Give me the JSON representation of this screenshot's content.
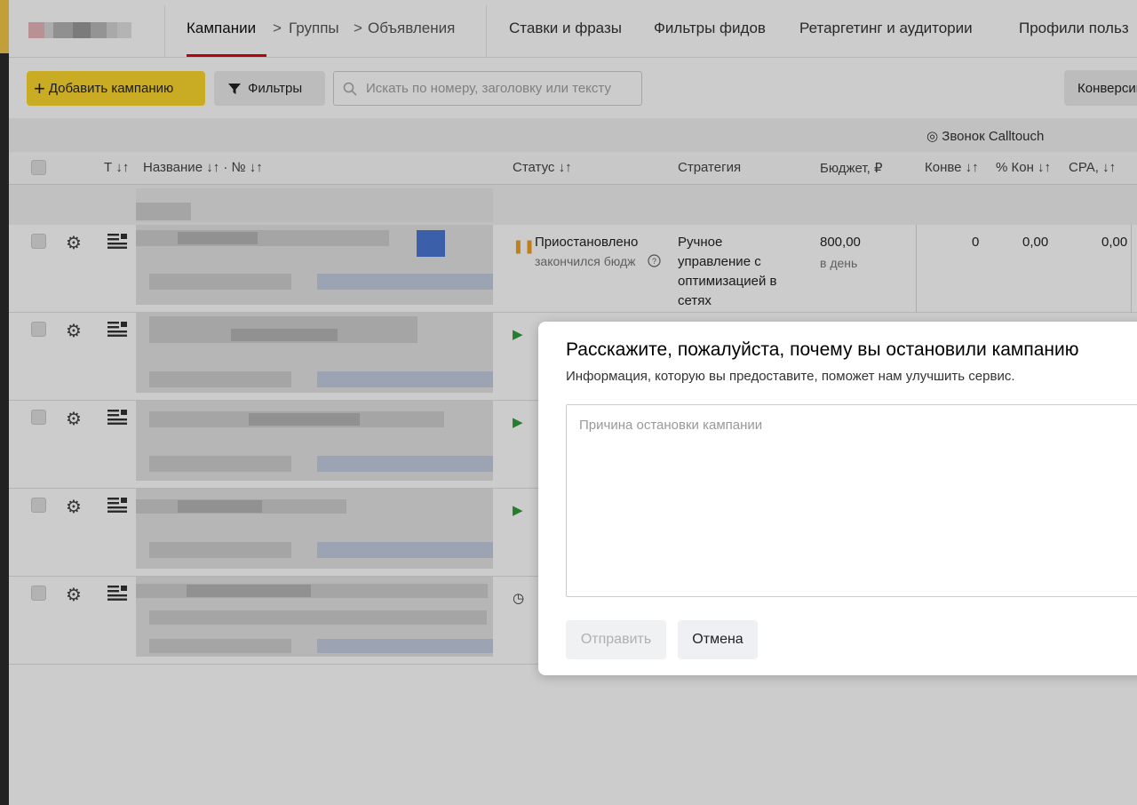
{
  "nav": {
    "campaigns": "Кампании",
    "sep1": ">",
    "groups": "Группы",
    "sep2": ">",
    "ads": "Объявления",
    "bids": "Ставки и фразы",
    "feed_filters": "Фильтры фидов",
    "retargeting": "Ретаргетинг и аудитории",
    "profiles": "Профили польз"
  },
  "toolbar": {
    "add_campaign": "Добавить кампанию",
    "filters": "Фильтры",
    "search_placeholder": "Искать по номеру, заголовку или тексту",
    "conversions": "Конверсии"
  },
  "table": {
    "group_header": "◎ Звонок Calltouch",
    "columns": {
      "sort_col": "Т ↓↑",
      "name": "Название ↓↑ · № ↓↑",
      "status": "Статус ↓↑",
      "strategy": "Стратегия",
      "budget": "Бюджет, ₽",
      "conv": "Конве ↓↑",
      "conv_pct": "% Кон ↓↑",
      "cpa": "CPA, ↓↑"
    },
    "row1": {
      "status": "Приостановлено",
      "status_sub": "закончился бюдж",
      "strategy": [
        "Ручное",
        "управление с",
        "оптимизацией в",
        "сетях"
      ],
      "budget": "800,00",
      "budget_sub": "в день",
      "conv": "0",
      "conv_pct": "0,00",
      "cpa": "0,00"
    }
  },
  "modal": {
    "title": "Расскажите, пожалуйста, почему вы остановили кампанию",
    "subtitle": "Информация, которую вы предоставите, поможет нам улучшить сервис.",
    "placeholder": "Причина остановки кампании",
    "send": "Отправить",
    "cancel": "Отмена"
  },
  "colors": {
    "accent_yellow": "#fcd72e",
    "nav_active": "#e30613",
    "paused_icon": "#f0a020",
    "active_icon": "#2e9e3a"
  }
}
